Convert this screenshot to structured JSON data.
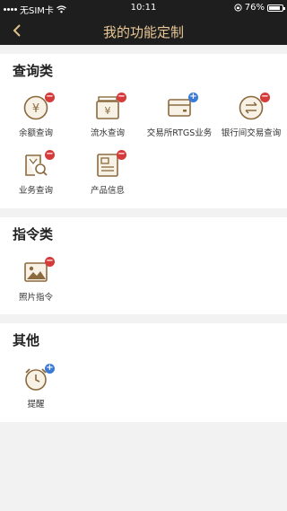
{
  "status_bar": {
    "carrier": "无SIM卡",
    "time": "10:11",
    "battery": "76%",
    "battery_level": 0.76
  },
  "nav": {
    "title": "我的功能定制",
    "back_icon": "chevron-left-icon"
  },
  "colors": {
    "header_bg": "#1e1e1e",
    "accent_gold": "#e8c896",
    "icon_brown": "#8b6a3e",
    "remove_badge": "#d63b3b",
    "add_badge": "#3a7bd5"
  },
  "sections": [
    {
      "title": "查询类",
      "items": [
        {
          "label": "余额查询",
          "icon": "yuan-coin-icon",
          "badge": "remove"
        },
        {
          "label": "流水查询",
          "icon": "yuan-register-icon",
          "badge": "remove"
        },
        {
          "label": "交易所RTGS业务",
          "icon": "card-icon",
          "badge": "add"
        },
        {
          "label": "银行间交易查询",
          "icon": "exchange-arrows-icon",
          "badge": "remove"
        },
        {
          "label": "业务查询",
          "icon": "document-search-icon",
          "badge": "remove"
        },
        {
          "label": "产品信息",
          "icon": "product-info-icon",
          "badge": "remove"
        }
      ]
    },
    {
      "title": "指令类",
      "items": [
        {
          "label": "照片指令",
          "icon": "photo-icon",
          "badge": "remove"
        }
      ]
    },
    {
      "title": "其他",
      "items": [
        {
          "label": "提醒",
          "icon": "alarm-clock-icon",
          "badge": "add"
        }
      ]
    }
  ]
}
